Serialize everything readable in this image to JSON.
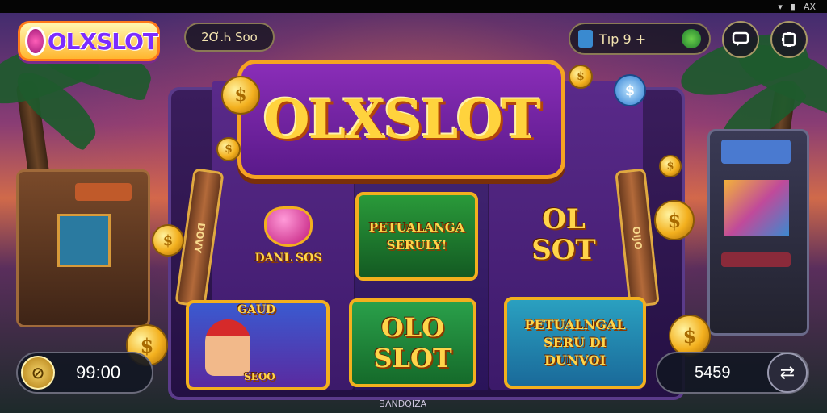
{
  "status_bar": {
    "icons": [
      "signal-icon",
      "battery-icon"
    ],
    "text": "AX"
  },
  "brand": {
    "logo_text": "OLXSLOT"
  },
  "top_left_pill": {
    "text": "2Ơ.Ꮒ Soo"
  },
  "top_right_pill": {
    "label": "Tıp 9 +"
  },
  "title_banner": {
    "text": "OLXSLOT"
  },
  "pillars": {
    "left_text": "DOVY",
    "right_text": "OIJO"
  },
  "reel_cards": [
    {
      "title": "DANL SOS",
      "icon": "gem-icon"
    },
    {
      "title": "PETUALANGA SERULY!",
      "icon": "sign-icon"
    },
    {
      "title": "OL SOT",
      "icon": "none"
    },
    {
      "title": "GAUD",
      "subtitle": "SEOO",
      "icon": "miner-icon"
    },
    {
      "title": "OLO SLOT",
      "icon": "none"
    },
    {
      "title": "PETUALNGAL SERU DI DUNVOI",
      "icon": "none"
    }
  ],
  "bottom_left": {
    "value": "99:00"
  },
  "bottom_right": {
    "value": "5459"
  },
  "footer_text": "ƎΛNDQIZA",
  "colors": {
    "accent_gold": "#ffd33d",
    "purple": "#5a1a8a",
    "green": "#1f7a2e"
  }
}
